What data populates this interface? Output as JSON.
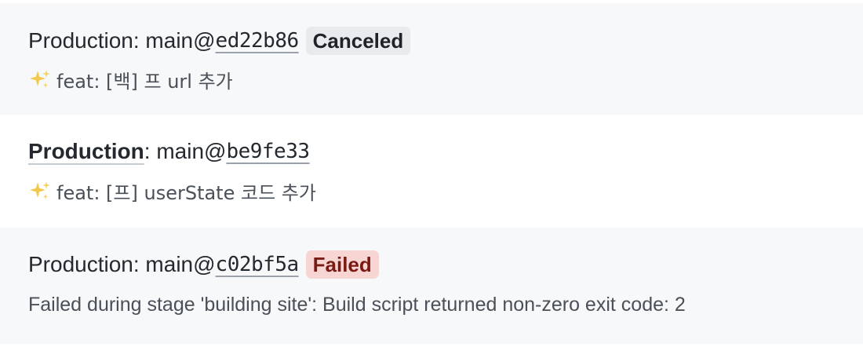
{
  "deployments": [
    {
      "environment": "Production",
      "separator": ": main@",
      "commit": "ed22b86",
      "status": "Canceled",
      "message_icon": "sparkles-icon",
      "message": "feat: [백] 프 url 추가"
    },
    {
      "environment": "Production",
      "separator": ": main@",
      "commit": "be9fe33",
      "message_icon": "sparkles-icon",
      "message": "feat: [프] userState 코드 추가"
    },
    {
      "environment": "Production",
      "separator": ": main@",
      "commit": "c02bf5a",
      "status": "Failed",
      "message": "Failed during stage 'building site': Build script returned non-zero exit code: 2"
    }
  ],
  "colors": {
    "row_alt_background": "#f7f8f9",
    "canceled_badge": "#e8eaed",
    "failed_badge": "#f6d5d3",
    "failed_text": "#7a1a14",
    "sparkle": "#f2c94c"
  }
}
